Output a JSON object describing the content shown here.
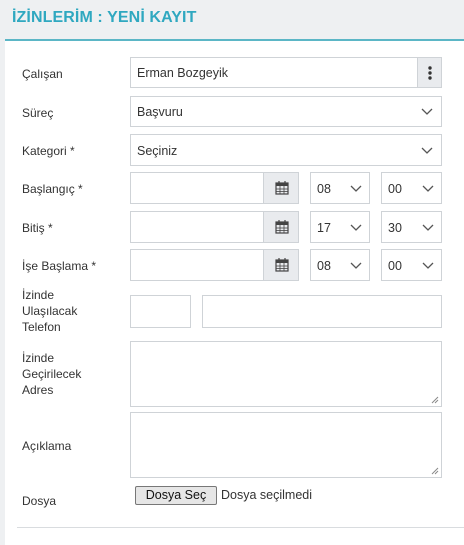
{
  "page": {
    "title": "İZİNLERİM : YENİ KAYIT"
  },
  "form": {
    "employee": {
      "label": "Çalışan",
      "value": "Erman Bozgeyik",
      "menu_icon": "kebab-menu-icon"
    },
    "process": {
      "label": "Süreç",
      "value": "Başvuru"
    },
    "category": {
      "label": "Kategori *",
      "value": "Seçiniz"
    },
    "start": {
      "label": "Başlangıç *",
      "date": "",
      "hour": "08",
      "minute": "00",
      "icon": "calendar-icon"
    },
    "end": {
      "label": "Bitiş *",
      "date": "",
      "hour": "17",
      "minute": "30",
      "icon": "calendar-icon"
    },
    "return": {
      "label": "İşe Başlama *",
      "date": "",
      "hour": "08",
      "minute": "00",
      "icon": "calendar-icon"
    },
    "phone": {
      "label_lines": [
        "İzinde",
        "Ulaşılacak",
        "Telefon"
      ],
      "code": "",
      "number": ""
    },
    "address": {
      "label_lines": [
        "İzinde",
        "Geçirilecek",
        "Adres"
      ],
      "value": ""
    },
    "description": {
      "label": "Açıklama",
      "value": ""
    },
    "file": {
      "label": "Dosya",
      "button": "Dosya Seç",
      "status": "Dosya seçilmedi"
    }
  },
  "colors": {
    "accent": "#2fa8c0",
    "border": "#cfd3d7",
    "addon_bg": "#e9ebee"
  }
}
